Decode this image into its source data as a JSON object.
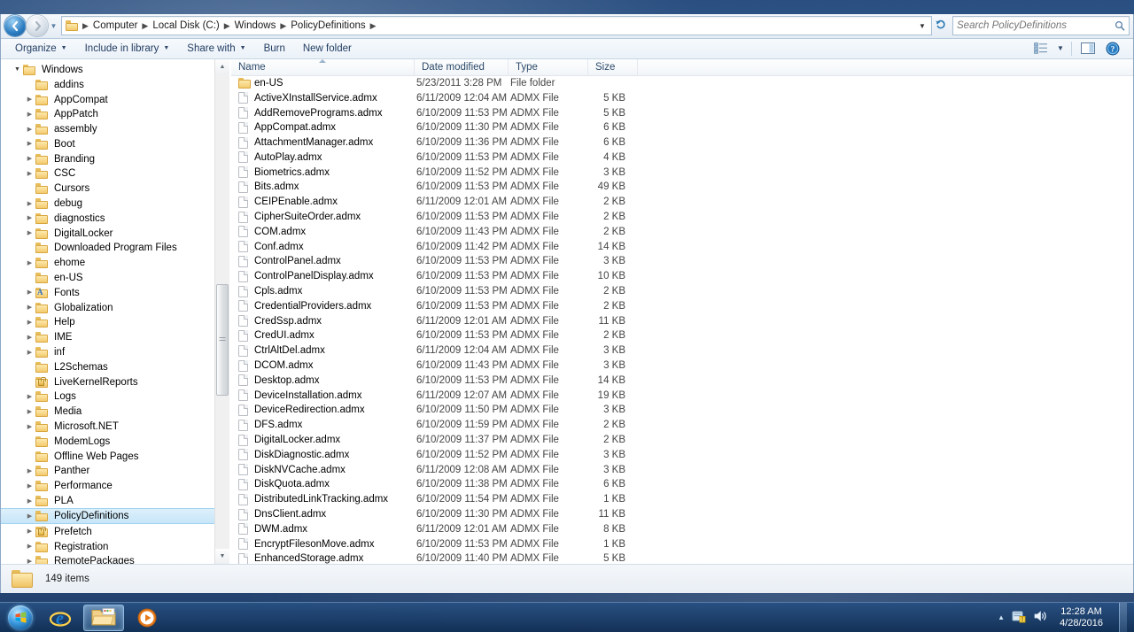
{
  "window": {
    "title": "PolicyDefinitions"
  },
  "addressbar": {
    "back_tooltip": "Back",
    "forward_tooltip": "Forward",
    "breadcrumbs": [
      "Computer",
      "Local Disk (C:)",
      "Windows",
      "PolicyDefinitions"
    ],
    "refresh_label": "Refresh",
    "search_placeholder": "Search PolicyDefinitions",
    "search_value": ""
  },
  "toolbar": {
    "items": [
      {
        "label": "Organize",
        "has_caret": true
      },
      {
        "label": "Include in library",
        "has_caret": true
      },
      {
        "label": "Share with",
        "has_caret": true
      },
      {
        "label": "Burn",
        "has_caret": false
      },
      {
        "label": "New folder",
        "has_caret": false
      }
    ],
    "right_icons": [
      "change-view-icon",
      "view-dropdown-caret",
      "preview-pane-icon",
      "help-icon"
    ]
  },
  "navpane": {
    "items": [
      {
        "label": "Windows",
        "indent": 0,
        "arrow": "open",
        "icon": "folder"
      },
      {
        "label": "addins",
        "indent": 1,
        "arrow": "none",
        "icon": "folder"
      },
      {
        "label": "AppCompat",
        "indent": 1,
        "arrow": "closed",
        "icon": "folder"
      },
      {
        "label": "AppPatch",
        "indent": 1,
        "arrow": "closed",
        "icon": "folder"
      },
      {
        "label": "assembly",
        "indent": 1,
        "arrow": "closed",
        "icon": "folder"
      },
      {
        "label": "Boot",
        "indent": 1,
        "arrow": "closed",
        "icon": "folder"
      },
      {
        "label": "Branding",
        "indent": 1,
        "arrow": "closed",
        "icon": "folder"
      },
      {
        "label": "CSC",
        "indent": 1,
        "arrow": "closed",
        "icon": "folder"
      },
      {
        "label": "Cursors",
        "indent": 1,
        "arrow": "none",
        "icon": "folder"
      },
      {
        "label": "debug",
        "indent": 1,
        "arrow": "closed",
        "icon": "folder"
      },
      {
        "label": "diagnostics",
        "indent": 1,
        "arrow": "closed",
        "icon": "folder"
      },
      {
        "label": "DigitalLocker",
        "indent": 1,
        "arrow": "closed",
        "icon": "folder"
      },
      {
        "label": "Downloaded Program Files",
        "indent": 1,
        "arrow": "none",
        "icon": "folder"
      },
      {
        "label": "ehome",
        "indent": 1,
        "arrow": "closed",
        "icon": "folder"
      },
      {
        "label": "en-US",
        "indent": 1,
        "arrow": "none",
        "icon": "folder"
      },
      {
        "label": "Fonts",
        "indent": 1,
        "arrow": "closed",
        "icon": "fonts-folder"
      },
      {
        "label": "Globalization",
        "indent": 1,
        "arrow": "closed",
        "icon": "folder"
      },
      {
        "label": "Help",
        "indent": 1,
        "arrow": "closed",
        "icon": "folder"
      },
      {
        "label": "IME",
        "indent": 1,
        "arrow": "closed",
        "icon": "folder"
      },
      {
        "label": "inf",
        "indent": 1,
        "arrow": "closed",
        "icon": "folder"
      },
      {
        "label": "L2Schemas",
        "indent": 1,
        "arrow": "none",
        "icon": "folder"
      },
      {
        "label": "LiveKernelReports",
        "indent": 1,
        "arrow": "none",
        "icon": "locked-folder"
      },
      {
        "label": "Logs",
        "indent": 1,
        "arrow": "closed",
        "icon": "folder"
      },
      {
        "label": "Media",
        "indent": 1,
        "arrow": "closed",
        "icon": "folder"
      },
      {
        "label": "Microsoft.NET",
        "indent": 1,
        "arrow": "closed",
        "icon": "folder"
      },
      {
        "label": "ModemLogs",
        "indent": 1,
        "arrow": "none",
        "icon": "folder"
      },
      {
        "label": "Offline Web Pages",
        "indent": 1,
        "arrow": "none",
        "icon": "folder"
      },
      {
        "label": "Panther",
        "indent": 1,
        "arrow": "closed",
        "icon": "folder"
      },
      {
        "label": "Performance",
        "indent": 1,
        "arrow": "closed",
        "icon": "folder"
      },
      {
        "label": "PLA",
        "indent": 1,
        "arrow": "closed",
        "icon": "folder"
      },
      {
        "label": "PolicyDefinitions",
        "indent": 1,
        "arrow": "closed",
        "icon": "folder",
        "selected": true
      },
      {
        "label": "Prefetch",
        "indent": 1,
        "arrow": "closed",
        "icon": "locked-folder"
      },
      {
        "label": "Registration",
        "indent": 1,
        "arrow": "closed",
        "icon": "folder"
      },
      {
        "label": "RemotePackages",
        "indent": 1,
        "arrow": "closed",
        "icon": "folder"
      }
    ]
  },
  "filelist": {
    "columns": [
      {
        "label": "Name",
        "sorted": "asc"
      },
      {
        "label": "Date modified"
      },
      {
        "label": "Type"
      },
      {
        "label": "Size"
      }
    ],
    "rows": [
      {
        "name": "en-US",
        "date": "5/23/2011 3:28 PM",
        "type": "File folder",
        "size": "",
        "icon": "folder"
      },
      {
        "name": "ActiveXInstallService.admx",
        "date": "6/11/2009 12:04 AM",
        "type": "ADMX File",
        "size": "5 KB",
        "icon": "file"
      },
      {
        "name": "AddRemovePrograms.admx",
        "date": "6/10/2009 11:53 PM",
        "type": "ADMX File",
        "size": "5 KB",
        "icon": "file"
      },
      {
        "name": "AppCompat.admx",
        "date": "6/10/2009 11:30 PM",
        "type": "ADMX File",
        "size": "6 KB",
        "icon": "file"
      },
      {
        "name": "AttachmentManager.admx",
        "date": "6/10/2009 11:36 PM",
        "type": "ADMX File",
        "size": "6 KB",
        "icon": "file"
      },
      {
        "name": "AutoPlay.admx",
        "date": "6/10/2009 11:53 PM",
        "type": "ADMX File",
        "size": "4 KB",
        "icon": "file"
      },
      {
        "name": "Biometrics.admx",
        "date": "6/10/2009 11:52 PM",
        "type": "ADMX File",
        "size": "3 KB",
        "icon": "file"
      },
      {
        "name": "Bits.admx",
        "date": "6/10/2009 11:53 PM",
        "type": "ADMX File",
        "size": "49 KB",
        "icon": "file"
      },
      {
        "name": "CEIPEnable.admx",
        "date": "6/11/2009 12:01 AM",
        "type": "ADMX File",
        "size": "2 KB",
        "icon": "file"
      },
      {
        "name": "CipherSuiteOrder.admx",
        "date": "6/10/2009 11:53 PM",
        "type": "ADMX File",
        "size": "2 KB",
        "icon": "file"
      },
      {
        "name": "COM.admx",
        "date": "6/10/2009 11:43 PM",
        "type": "ADMX File",
        "size": "2 KB",
        "icon": "file"
      },
      {
        "name": "Conf.admx",
        "date": "6/10/2009 11:42 PM",
        "type": "ADMX File",
        "size": "14 KB",
        "icon": "file"
      },
      {
        "name": "ControlPanel.admx",
        "date": "6/10/2009 11:53 PM",
        "type": "ADMX File",
        "size": "3 KB",
        "icon": "file"
      },
      {
        "name": "ControlPanelDisplay.admx",
        "date": "6/10/2009 11:53 PM",
        "type": "ADMX File",
        "size": "10 KB",
        "icon": "file"
      },
      {
        "name": "Cpls.admx",
        "date": "6/10/2009 11:53 PM",
        "type": "ADMX File",
        "size": "2 KB",
        "icon": "file"
      },
      {
        "name": "CredentialProviders.admx",
        "date": "6/10/2009 11:53 PM",
        "type": "ADMX File",
        "size": "2 KB",
        "icon": "file"
      },
      {
        "name": "CredSsp.admx",
        "date": "6/11/2009 12:01 AM",
        "type": "ADMX File",
        "size": "11 KB",
        "icon": "file"
      },
      {
        "name": "CredUI.admx",
        "date": "6/10/2009 11:53 PM",
        "type": "ADMX File",
        "size": "2 KB",
        "icon": "file"
      },
      {
        "name": "CtrlAltDel.admx",
        "date": "6/11/2009 12:04 AM",
        "type": "ADMX File",
        "size": "3 KB",
        "icon": "file"
      },
      {
        "name": "DCOM.admx",
        "date": "6/10/2009 11:43 PM",
        "type": "ADMX File",
        "size": "3 KB",
        "icon": "file"
      },
      {
        "name": "Desktop.admx",
        "date": "6/10/2009 11:53 PM",
        "type": "ADMX File",
        "size": "14 KB",
        "icon": "file"
      },
      {
        "name": "DeviceInstallation.admx",
        "date": "6/11/2009 12:07 AM",
        "type": "ADMX File",
        "size": "19 KB",
        "icon": "file"
      },
      {
        "name": "DeviceRedirection.admx",
        "date": "6/10/2009 11:50 PM",
        "type": "ADMX File",
        "size": "3 KB",
        "icon": "file"
      },
      {
        "name": "DFS.admx",
        "date": "6/10/2009 11:59 PM",
        "type": "ADMX File",
        "size": "2 KB",
        "icon": "file"
      },
      {
        "name": "DigitalLocker.admx",
        "date": "6/10/2009 11:37 PM",
        "type": "ADMX File",
        "size": "2 KB",
        "icon": "file"
      },
      {
        "name": "DiskDiagnostic.admx",
        "date": "6/10/2009 11:52 PM",
        "type": "ADMX File",
        "size": "3 KB",
        "icon": "file"
      },
      {
        "name": "DiskNVCache.admx",
        "date": "6/11/2009 12:08 AM",
        "type": "ADMX File",
        "size": "3 KB",
        "icon": "file"
      },
      {
        "name": "DiskQuota.admx",
        "date": "6/10/2009 11:38 PM",
        "type": "ADMX File",
        "size": "6 KB",
        "icon": "file"
      },
      {
        "name": "DistributedLinkTracking.admx",
        "date": "6/10/2009 11:54 PM",
        "type": "ADMX File",
        "size": "1 KB",
        "icon": "file"
      },
      {
        "name": "DnsClient.admx",
        "date": "6/10/2009 11:30 PM",
        "type": "ADMX File",
        "size": "11 KB",
        "icon": "file"
      },
      {
        "name": "DWM.admx",
        "date": "6/11/2009 12:01 AM",
        "type": "ADMX File",
        "size": "8 KB",
        "icon": "file"
      },
      {
        "name": "EncryptFilesonMove.admx",
        "date": "6/10/2009 11:53 PM",
        "type": "ADMX File",
        "size": "1 KB",
        "icon": "file"
      },
      {
        "name": "EnhancedStorage.admx",
        "date": "6/10/2009 11:40 PM",
        "type": "ADMX File",
        "size": "5 KB",
        "icon": "file"
      }
    ]
  },
  "statusbar": {
    "item_count": "149 items"
  },
  "taskbar": {
    "start_label": "Start",
    "buttons": [
      {
        "name": "internet-explorer",
        "active": false
      },
      {
        "name": "windows-explorer",
        "active": true
      },
      {
        "name": "windows-media-player",
        "active": false
      }
    ],
    "tray": {
      "overflow_arrow": "▲",
      "action_center": "action-center-icon",
      "volume": "volume-icon"
    },
    "clock_time": "12:28 AM",
    "clock_date": "4/28/2016"
  },
  "colors": {
    "accent": "#2a7bc0",
    "selection": "#c7e6f8",
    "folder": "#f3ca6d",
    "taskbar": "#1e4madness"
  }
}
